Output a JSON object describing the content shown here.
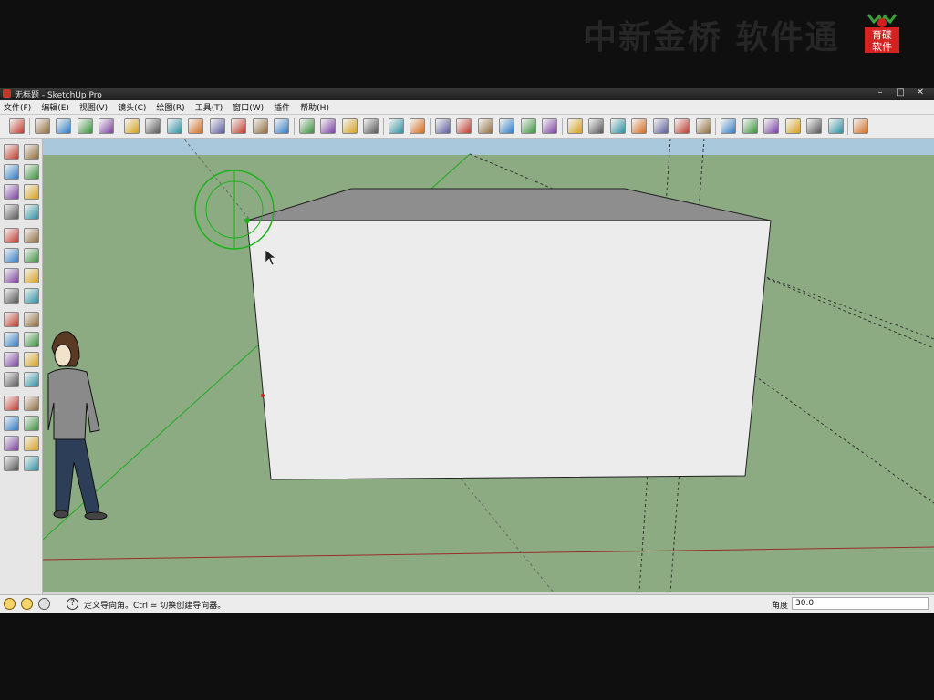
{
  "overlay": {
    "watermark": "中新金桥 软件通",
    "logo_text": "育碟软件"
  },
  "window": {
    "title": "无标题 - SketchUp Pro",
    "minimize": "–",
    "maximize": "□",
    "close": "✕"
  },
  "menu": [
    "文件(F)",
    "编辑(E)",
    "视图(V)",
    "镜头(C)",
    "绘图(R)",
    "工具(T)",
    "窗口(W)",
    "插件",
    "帮助(H)"
  ],
  "toolbar": {
    "icons": [
      "select-icon",
      "line-icon",
      "rectangle-icon",
      "circle-icon",
      "arc-icon",
      "make-component-icon",
      "eraser-icon",
      "tape-measure-icon",
      "paint-bucket-icon",
      "push-pull-icon",
      "follow-me-icon",
      "rotate-icon",
      "offset-icon",
      "orbit-icon",
      "pan-icon",
      "zoom-icon",
      "zoom-extents-icon",
      "previous-view-icon",
      "next-view-icon",
      "add-location-icon",
      "toggle-terrain-icon",
      "get-models-icon",
      "share-model-icon",
      "get-models-2-icon",
      "share-component-icon",
      "photo-textures-icon",
      "iso-view-icon",
      "top-view-icon",
      "front-view-icon",
      "right-view-icon",
      "back-view-icon",
      "left-view-icon",
      "xray-icon",
      "wireframe-icon",
      "hidden-line-icon",
      "shaded-icon",
      "shaded-textures-icon",
      "monochrome-icon",
      "section-icon"
    ]
  },
  "left_toolbar": {
    "icons": [
      "select-icon",
      "make-component-icon",
      "paint-bucket-icon",
      "eraser-icon",
      "rectangle-icon",
      "line-icon",
      "circle-icon",
      "arc-icon",
      "polygon-icon",
      "freehand-icon",
      "move-icon",
      "push-pull-icon",
      "rotate-icon",
      "follow-me-icon",
      "scale-icon",
      "offset-icon",
      "tape-measure-icon",
      "dimension-icon",
      "protractor-icon",
      "text-icon",
      "axes-icon",
      "3d-text-icon",
      "orbit-icon",
      "pan-icon",
      "zoom-icon",
      "zoom-window-icon",
      "zoom-extents-icon",
      "previous-icon",
      "position-camera-icon",
      "look-around-icon",
      "walk-icon",
      "section-plane-icon"
    ]
  },
  "status": {
    "hint": "定义导向角。Ctrl = 切换创建导向器。",
    "vcb_label": "角度",
    "vcb_value": "30.0"
  },
  "colors": {
    "ground": "#8cab82",
    "sky": "#aac8dc",
    "box_front": "#ececec",
    "box_top": "#8e8e8e",
    "protractor": "#19b319"
  }
}
